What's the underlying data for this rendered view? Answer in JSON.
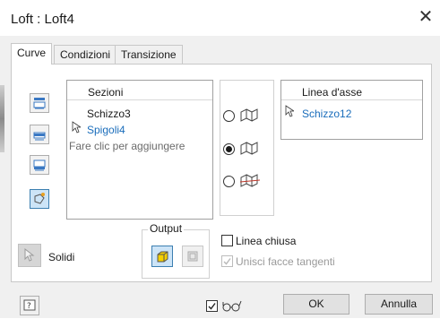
{
  "window": {
    "title": "Loft : Loft4",
    "close_icon": "close-icon"
  },
  "tabs": [
    {
      "label": "Curve",
      "active": true
    },
    {
      "label": "Condizioni",
      "active": false
    },
    {
      "label": "Transizione",
      "active": false
    }
  ],
  "sections": {
    "header": "Sezioni",
    "items": [
      {
        "label": "Schizzo3",
        "color": "#1a1a1a"
      },
      {
        "label": "Spigoli4",
        "color": "#1a6dbb"
      }
    ],
    "add_prompt": "Fare clic per aggiungere"
  },
  "rail": {
    "header": "Linea d'asse",
    "items": [
      {
        "label": "Schizzo12",
        "color": "#1a6dbb"
      }
    ]
  },
  "mode": {
    "options": [
      "rails-icon",
      "centerline-icon",
      "area-loft-icon"
    ],
    "selected_index": 1
  },
  "solids_label": "Solidi",
  "output": {
    "label": "Output",
    "options": [
      "solid-icon",
      "surface-icon"
    ],
    "selected_index": 0
  },
  "options": {
    "closed_loop": {
      "label": "Linea chiusa",
      "checked": false,
      "enabled": true
    },
    "merge_tangent": {
      "label": "Unisci facce tangenti",
      "checked": true,
      "enabled": false
    }
  },
  "footer": {
    "help_icon": "help-icon",
    "preview_checked": true,
    "preview_icon": "glasses-icon",
    "ok_label": "OK",
    "cancel_label": "Annulla"
  },
  "colors": {
    "accent": "#1a6dbb",
    "selected_bg": "#cce4f7",
    "selected_border": "#3c7fb1"
  }
}
